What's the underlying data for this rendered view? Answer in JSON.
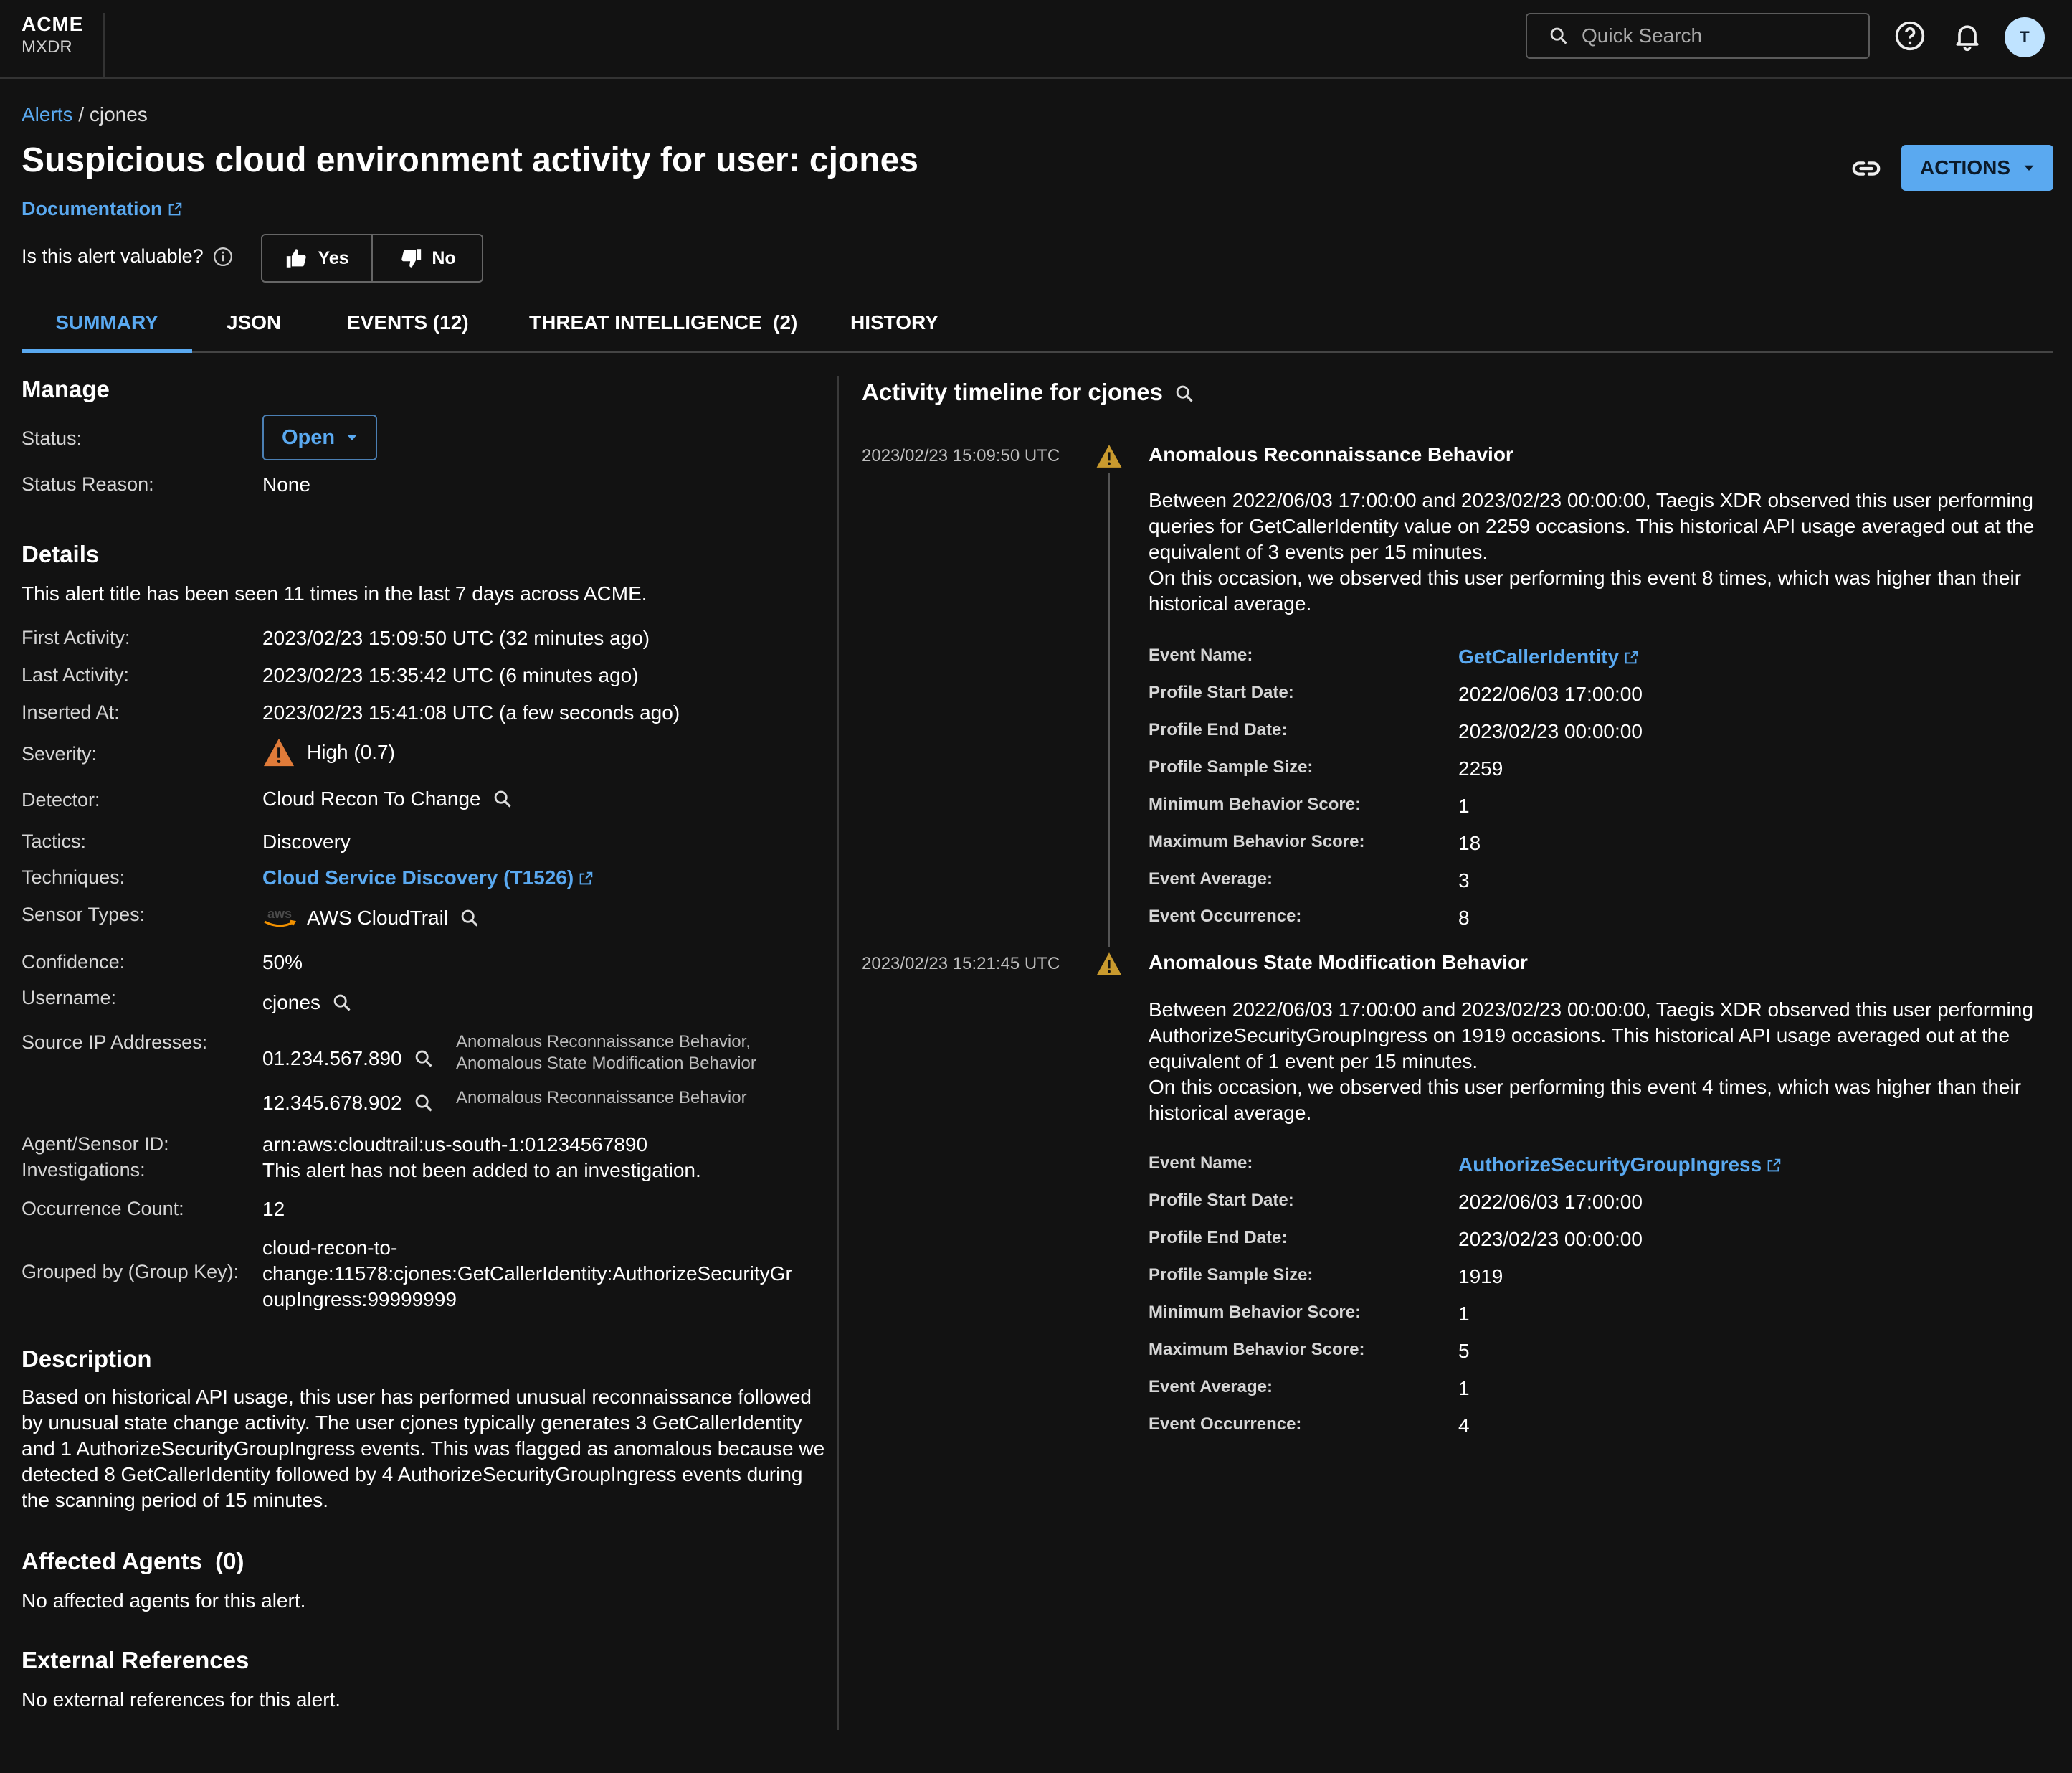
{
  "brand": {
    "line1": "ACME",
    "line2": "MXDR"
  },
  "topbar": {
    "search_placeholder": "Quick Search",
    "avatar": "T"
  },
  "breadcrumb": {
    "root": "Alerts",
    "sep": "/",
    "current": "cjones"
  },
  "page": {
    "title": "Suspicious cloud environment activity for user: cjones",
    "documentation": "Documentation",
    "valuable_q": "Is this alert valuable?",
    "yes": "Yes",
    "no": "No",
    "actions": "ACTIONS"
  },
  "tabs": [
    "SUMMARY",
    "JSON",
    "EVENTS (12)",
    "THREAT INTELLIGENCE  (2)",
    "HISTORY"
  ],
  "manage": {
    "heading": "Manage",
    "status_label": "Status:",
    "status_value": "Open",
    "reason_label": "Status Reason:",
    "reason_value": "None"
  },
  "details": {
    "heading": "Details",
    "seen": "This alert title has been seen 11 times in the last 7 days across ACME.",
    "rows": [
      {
        "label": "First Activity:",
        "value": "2023/02/23 15:09:50 UTC (32 minutes ago)"
      },
      {
        "label": "Last Activity:",
        "value": "2023/02/23 15:35:42 UTC (6 minutes ago)"
      },
      {
        "label": "Inserted At:",
        "value": "2023/02/23 15:41:08 UTC (a few seconds ago)"
      },
      {
        "label": "Severity:",
        "value": "High (0.7)"
      },
      {
        "label": "Detector:",
        "value": "Cloud Recon To Change"
      },
      {
        "label": "Tactics:",
        "value": "Discovery"
      },
      {
        "label": "Techniques:",
        "value": "Cloud Service Discovery (T1526)"
      },
      {
        "label": "Sensor Types:",
        "value": "AWS CloudTrail"
      },
      {
        "label": "Confidence:",
        "value": "50%"
      },
      {
        "label": "Username:",
        "value": "cjones"
      },
      {
        "label": "Source IP Addresses:",
        "value": ""
      },
      {
        "label": "Agent/Sensor ID:",
        "value": "arn:aws:cloudtrail:us-south-1:01234567890"
      },
      {
        "label": "Investigations:",
        "value": "This alert has not been added to an investigation."
      },
      {
        "label": "Occurrence Count:",
        "value": "12"
      },
      {
        "label": "Grouped by (Group Key):",
        "value": ""
      }
    ],
    "ips": [
      {
        "ip": "01.234.567.890",
        "note1": "Anomalous Reconnaissance Behavior,",
        "note2": "Anomalous State Modification Behavior"
      },
      {
        "ip": "12.345.678.902",
        "note1": "Anomalous Reconnaissance Behavior",
        "note2": ""
      }
    ],
    "group_key": [
      "cloud-recon-to-",
      "change:11578:cjones:GetCallerIdentity:AuthorizeSecurityGr",
      "oupIngress:99999999"
    ],
    "aws_logo": "aws"
  },
  "description": {
    "heading": "Description",
    "lines": [
      "Based on historical API usage, this user has performed unusual reconnaissance followed",
      "by unusual state change activity. The user cjones typically generates 3 GetCallerIdentity",
      "and 1 AuthorizeSecurityGroupIngress events. This was flagged as anomalous because we",
      "detected 8 GetCallerIdentity followed by 4 AuthorizeSecurityGroupIngress events during",
      "the scanning period of 15 minutes."
    ]
  },
  "affected": {
    "heading": "Affected Agents  (0)",
    "text": "No affected agents for this alert."
  },
  "external": {
    "heading": "External References",
    "text": "No external references for this alert."
  },
  "timeline": {
    "heading": "Activity timeline for cjones",
    "events": [
      {
        "time": "2023/02/23 15:09:50 UTC",
        "title": "Anomalous Reconnaissance Behavior",
        "lines": [
          "Between 2022/06/03 17:00:00 and 2023/02/23 00:00:00, Taegis XDR observed this user performing",
          "queries for GetCallerIdentity value on 2259 occasions. This historical API usage averaged out at the",
          "equivalent of 3 events per 15 minutes.",
          "On this occasion, we observed this user performing this event 8 times, which was higher than their",
          "historical average."
        ],
        "fields": [
          {
            "label": "Event Name:",
            "value": "GetCallerIdentity"
          },
          {
            "label": "Profile Start Date:",
            "value": "2022/06/03 17:00:00"
          },
          {
            "label": "Profile End Date:",
            "value": "2023/02/23 00:00:00"
          },
          {
            "label": "Profile Sample Size:",
            "value": "2259"
          },
          {
            "label": "Minimum Behavior Score:",
            "value": "1"
          },
          {
            "label": "Maximum Behavior Score:",
            "value": "18"
          },
          {
            "label": "Event Average:",
            "value": "3"
          },
          {
            "label": "Event Occurrence:",
            "value": "8"
          }
        ]
      },
      {
        "time": "2023/02/23 15:21:45 UTC",
        "title": "Anomalous State Modification Behavior",
        "lines": [
          "Between 2022/06/03 17:00:00 and 2023/02/23 00:00:00, Taegis XDR observed this user performing",
          "AuthorizeSecurityGroupIngress on 1919 occasions. This historical API usage averaged out at the",
          "equivalent of 1 event per 15 minutes.",
          "On this occasion, we observed this user performing this event 4 times, which was higher than their",
          "historical average."
        ],
        "fields": [
          {
            "label": "Event Name:",
            "value": "AuthorizeSecurityGroupIngress"
          },
          {
            "label": "Profile Start Date:",
            "value": "2022/06/03 17:00:00"
          },
          {
            "label": "Profile End Date:",
            "value": "2023/02/23 00:00:00"
          },
          {
            "label": "Profile Sample Size:",
            "value": "1919"
          },
          {
            "label": "Minimum Behavior Score:",
            "value": "1"
          },
          {
            "label": "Maximum Behavior Score:",
            "value": "5"
          },
          {
            "label": "Event Average:",
            "value": "1"
          },
          {
            "label": "Event Occurrence:",
            "value": "4"
          }
        ]
      }
    ]
  },
  "colors": {
    "accent": "#5aa9f0",
    "background": "#121212",
    "warning": "#e07b39",
    "warning_small": "#c99a2e"
  }
}
